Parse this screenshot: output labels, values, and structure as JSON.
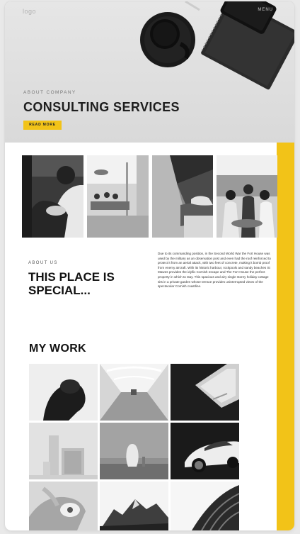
{
  "header": {
    "logo": "logo",
    "menu": "MENU"
  },
  "hero": {
    "eyebrow": "ABOUT COMPANY",
    "title": "CONSULTING SERVICES",
    "button_label": "READ MORE"
  },
  "team_photos": [
    {
      "alt": "team-photo-1"
    },
    {
      "alt": "team-photo-2"
    },
    {
      "alt": "team-photo-3"
    },
    {
      "alt": "team-photo-4"
    }
  ],
  "about": {
    "eyebrow": "ABOUT US",
    "title": "THIS PLACE IS SPECIAL...",
    "body": "Due to its commanding position, in the Second World War the Fort House was used by the military as an observation post and even had the roof reinforced to protect it from an aerial attack, with two feet of concrete, making it bomb proof from enemy aircraft. With its historic harbour, rockpools and sandy beaches St Mawes provides the idyllic Cornish escape and The Fort House the perfect property in which to stay. This spacious and airy single storey holiday cottage sits in a private garden whose terrace provides uninterrupted views of the spectacular Cornish coastline."
  },
  "work": {
    "title": "MY WORK"
  },
  "colors": {
    "accent": "#f2c318",
    "text_dark": "#1e1e1e",
    "hero_bg": "#e0e0e0"
  }
}
